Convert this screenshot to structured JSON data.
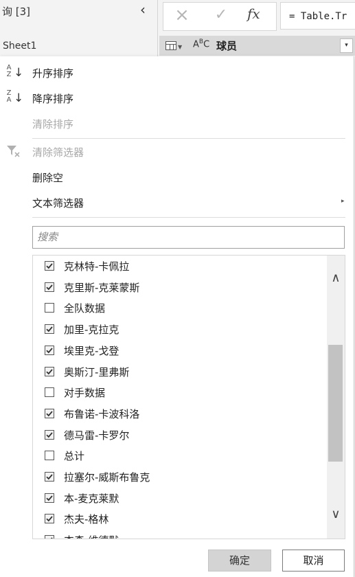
{
  "query_pane": {
    "title": "询 [3]",
    "collapse_icon": "chevron-left",
    "item": "Sheet1"
  },
  "formula_bar": {
    "cancel_icon": "×",
    "confirm_icon": "✓",
    "fx_label": "fx",
    "formula_text": "= Table.Tr"
  },
  "column_header": {
    "type_icon_text": "A",
    "type_icon_sup": "B",
    "type_icon_sub": "C",
    "name": "球员",
    "dropdown_icon": "▾"
  },
  "menu": {
    "sort_asc": {
      "label": "升序排序",
      "icon_top": "A",
      "icon_bottom": "Z",
      "arrow": "↓"
    },
    "sort_desc": {
      "label": "降序排序",
      "icon_top": "Z",
      "icon_bottom": "A",
      "arrow": "↓"
    },
    "clear_sort": {
      "label": "清除排序"
    },
    "clear_filter": {
      "label": "清除筛选器"
    },
    "remove_empty": {
      "label": "删除空"
    },
    "text_filters": {
      "label": "文本筛选器",
      "arrow": "▸"
    }
  },
  "search": {
    "placeholder": "搜索"
  },
  "filter_list": [
    {
      "label": "克林特-卡佩拉",
      "checked": true
    },
    {
      "label": "克里斯-克莱蒙斯",
      "checked": true
    },
    {
      "label": "全队数据",
      "checked": false
    },
    {
      "label": "加里-克拉克",
      "checked": true
    },
    {
      "label": "埃里克-戈登",
      "checked": true
    },
    {
      "label": "奥斯汀-里弗斯",
      "checked": true
    },
    {
      "label": "对手数据",
      "checked": false
    },
    {
      "label": "布鲁诺-卡波科洛",
      "checked": true
    },
    {
      "label": "德马雷-卡罗尔",
      "checked": true
    },
    {
      "label": "总计",
      "checked": false
    },
    {
      "label": "拉塞尔-威斯布鲁克",
      "checked": true
    },
    {
      "label": "本-麦克莱默",
      "checked": true
    },
    {
      "label": "杰夫-格林",
      "checked": true
    },
    {
      "label": "杰森-维德默",
      "checked": true
    }
  ],
  "scroll_up_icon": "∧",
  "scroll_down_icon": "∨",
  "buttons": {
    "ok": "确定",
    "cancel": "取消"
  },
  "colors": {
    "panel_bg": "#ffffff",
    "header_bg": "#d9d9d9",
    "disabled_text": "#a8a8a8",
    "scroll_thumb": "#c2c2c2"
  }
}
